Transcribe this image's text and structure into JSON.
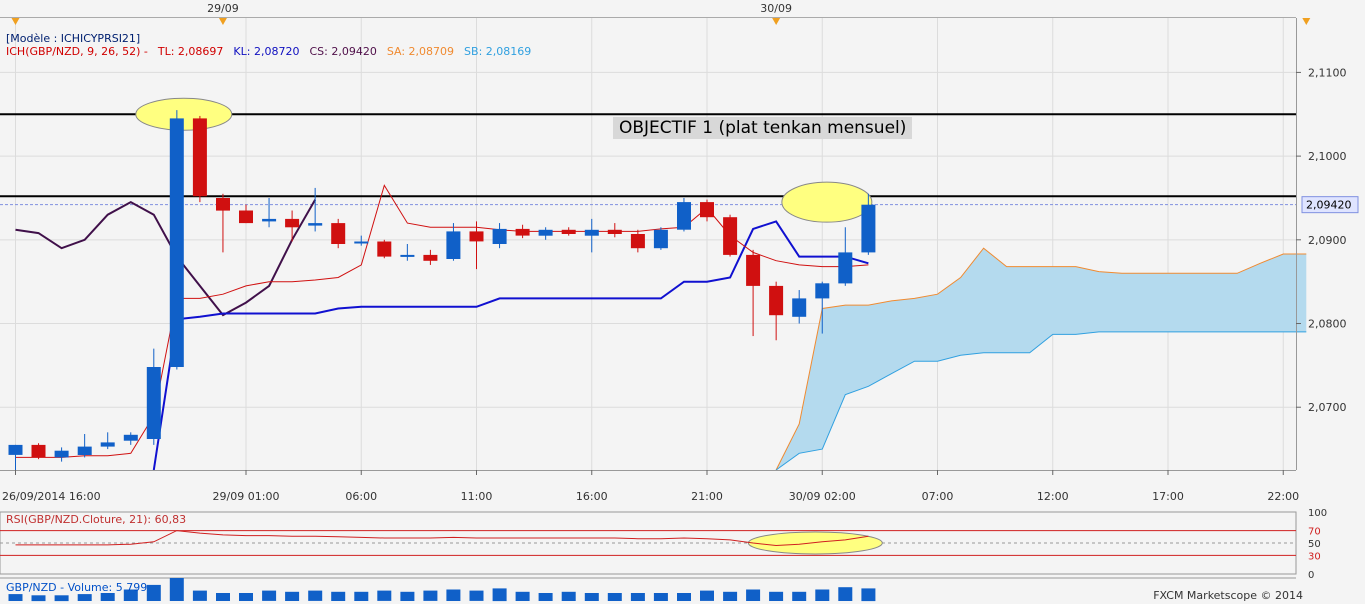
{
  "header": {
    "model": "[Modèle : ICHICYPRSI21]",
    "ichimoku_label": "ICH(GBP/NZD, 9, 26, 52) -",
    "tl_label": "TL: 2,08697",
    "kl_label": "KL: 2,08720",
    "cs_label": "CS: 2,09420",
    "sa_label": "SA: 2,08709",
    "sb_label": "SB: 2,08169"
  },
  "top_markers": [
    "29/09",
    "30/09"
  ],
  "annotation": "OBJECTIF 1 (plat tenkan mensuel)",
  "price_axis": {
    "ticks": [
      "2,1100",
      "2,1000",
      "2,0900",
      "2,0800",
      "2,0700"
    ],
    "tick_values": [
      2.11,
      2.1,
      2.09,
      2.08,
      2.07
    ],
    "ylim": [
      2.0625,
      2.1165
    ],
    "current": "2,09420",
    "current_value": 2.0942
  },
  "time_axis": {
    "labels": [
      "26/09/2014 16:00",
      "29/09 01:00",
      "06:00",
      "11:00",
      "16:00",
      "21:00",
      "30/09 02:00",
      "07:00",
      "12:00",
      "17:00",
      "22:00"
    ],
    "label_slots": [
      0,
      10,
      15,
      20,
      25,
      30,
      35,
      40,
      45,
      50,
      55
    ]
  },
  "rsi": {
    "label": "RSI(GBP/NZD.Cloture, 21): 60,83",
    "ticks": [
      "100",
      "70",
      "50",
      "30",
      "0"
    ],
    "tick_values": [
      100,
      70,
      50,
      30,
      0
    ],
    "value": 60.83
  },
  "volume": {
    "label": "GBP/NZD - Volume: 5 799"
  },
  "footer": "FXCM Marketscope © 2014",
  "colors": {
    "bull": "#1060c8",
    "bear": "#d01010",
    "tenkan": "#d01010",
    "kijun": "#1010d0",
    "chikou": "#40104a",
    "senkou_a": "#f08a30",
    "senkou_b": "#30a0e0",
    "cloud": "#b4daee",
    "highlight": "#ffff80",
    "rsi_line": "#d02020"
  },
  "chart_data": {
    "type": "candlestick",
    "symbol": "GBP/NZD",
    "timeframe": "1 hour",
    "horizontal_lines": [
      2.105,
      2.0952
    ],
    "candles": [
      {
        "o": 2.0643,
        "h": 2.0655,
        "l": 2.0625,
        "c": 2.0655
      },
      {
        "o": 2.0655,
        "h": 2.0657,
        "l": 2.0638,
        "c": 2.064
      },
      {
        "o": 2.064,
        "h": 2.0652,
        "l": 2.0635,
        "c": 2.0648
      },
      {
        "o": 2.0643,
        "h": 2.0668,
        "l": 2.064,
        "c": 2.0653
      },
      {
        "o": 2.0653,
        "h": 2.067,
        "l": 2.065,
        "c": 2.0658
      },
      {
        "o": 2.066,
        "h": 2.067,
        "l": 2.0655,
        "c": 2.0667
      },
      {
        "o": 2.0662,
        "h": 2.077,
        "l": 2.0655,
        "c": 2.0748
      },
      {
        "o": 2.0748,
        "h": 2.1055,
        "l": 2.0745,
        "c": 2.1045
      },
      {
        "o": 2.1045,
        "h": 2.1048,
        "l": 2.0945,
        "c": 2.0952
      },
      {
        "o": 2.095,
        "h": 2.0955,
        "l": 2.0885,
        "c": 2.0935
      },
      {
        "o": 2.0935,
        "h": 2.0942,
        "l": 2.092,
        "c": 2.092
      },
      {
        "o": 2.0922,
        "h": 2.095,
        "l": 2.0915,
        "c": 2.0925
      },
      {
        "o": 2.0925,
        "h": 2.0935,
        "l": 2.0898,
        "c": 2.0915
      },
      {
        "o": 2.0917,
        "h": 2.0962,
        "l": 2.091,
        "c": 2.092
      },
      {
        "o": 2.092,
        "h": 2.0925,
        "l": 2.089,
        "c": 2.0895
      },
      {
        "o": 2.0897,
        "h": 2.0905,
        "l": 2.0893,
        "c": 2.0898
      },
      {
        "o": 2.0898,
        "h": 2.09,
        "l": 2.0878,
        "c": 2.088
      },
      {
        "o": 2.088,
        "h": 2.0895,
        "l": 2.0875,
        "c": 2.0882
      },
      {
        "o": 2.0882,
        "h": 2.0888,
        "l": 2.087,
        "c": 2.0875
      },
      {
        "o": 2.0877,
        "h": 2.092,
        "l": 2.0875,
        "c": 2.091
      },
      {
        "o": 2.091,
        "h": 2.0922,
        "l": 2.0865,
        "c": 2.0898
      },
      {
        "o": 2.0895,
        "h": 2.092,
        "l": 2.089,
        "c": 2.0913
      },
      {
        "o": 2.0913,
        "h": 2.0918,
        "l": 2.0902,
        "c": 2.0905
      },
      {
        "o": 2.0905,
        "h": 2.0915,
        "l": 2.09,
        "c": 2.0912
      },
      {
        "o": 2.0912,
        "h": 2.0915,
        "l": 2.0905,
        "c": 2.0907
      },
      {
        "o": 2.0905,
        "h": 2.0925,
        "l": 2.0885,
        "c": 2.0912
      },
      {
        "o": 2.0912,
        "h": 2.092,
        "l": 2.0903,
        "c": 2.0907
      },
      {
        "o": 2.0907,
        "h": 2.0912,
        "l": 2.0885,
        "c": 2.089
      },
      {
        "o": 2.089,
        "h": 2.0915,
        "l": 2.0888,
        "c": 2.0912
      },
      {
        "o": 2.0912,
        "h": 2.095,
        "l": 2.091,
        "c": 2.0945
      },
      {
        "o": 2.0945,
        "h": 2.0948,
        "l": 2.0922,
        "c": 2.0927
      },
      {
        "o": 2.0927,
        "h": 2.093,
        "l": 2.088,
        "c": 2.0882
      },
      {
        "o": 2.0882,
        "h": 2.0888,
        "l": 2.0785,
        "c": 2.0845
      },
      {
        "o": 2.0845,
        "h": 2.085,
        "l": 2.078,
        "c": 2.081
      },
      {
        "o": 2.0808,
        "h": 2.084,
        "l": 2.08,
        "c": 2.083
      },
      {
        "o": 2.083,
        "h": 2.085,
        "l": 2.0788,
        "c": 2.0848
      },
      {
        "o": 2.0848,
        "h": 2.0915,
        "l": 2.0845,
        "c": 2.0885
      },
      {
        "o": 2.0885,
        "h": 2.0955,
        "l": 2.0882,
        "c": 2.0942
      }
    ],
    "tenkan": [
      [
        0,
        2.064
      ],
      [
        1,
        2.064
      ],
      [
        2,
        2.064
      ],
      [
        3,
        2.0642
      ],
      [
        4,
        2.0642
      ],
      [
        5,
        2.0645
      ],
      [
        6,
        2.069
      ],
      [
        7,
        2.083
      ],
      [
        8,
        2.083
      ],
      [
        9,
        2.0835
      ],
      [
        10,
        2.0845
      ],
      [
        11,
        2.085
      ],
      [
        12,
        2.085
      ],
      [
        13,
        2.0852
      ],
      [
        14,
        2.0855
      ],
      [
        15,
        2.087
      ],
      [
        16,
        2.0965
      ],
      [
        17,
        2.092
      ],
      [
        18,
        2.0915
      ],
      [
        19,
        2.0915
      ],
      [
        20,
        2.0915
      ],
      [
        21,
        2.0912
      ],
      [
        22,
        2.091
      ],
      [
        23,
        2.091
      ],
      [
        24,
        2.091
      ],
      [
        25,
        2.091
      ],
      [
        26,
        2.091
      ],
      [
        27,
        2.091
      ],
      [
        28,
        2.0913
      ],
      [
        29,
        2.0915
      ],
      [
        30,
        2.0938
      ],
      [
        31,
        2.0905
      ],
      [
        32,
        2.0885
      ],
      [
        33,
        2.0875
      ],
      [
        34,
        2.087
      ],
      [
        35,
        2.0868
      ],
      [
        36,
        2.0868
      ],
      [
        37,
        2.087
      ]
    ],
    "kijun": [
      [
        6,
        2.0625
      ],
      [
        7,
        2.0805
      ],
      [
        8,
        2.0808
      ],
      [
        9,
        2.0812
      ],
      [
        10,
        2.0812
      ],
      [
        11,
        2.0812
      ],
      [
        12,
        2.0812
      ],
      [
        13,
        2.0812
      ],
      [
        14,
        2.0818
      ],
      [
        15,
        2.082
      ],
      [
        16,
        2.082
      ],
      [
        17,
        2.082
      ],
      [
        18,
        2.082
      ],
      [
        19,
        2.082
      ],
      [
        20,
        2.082
      ],
      [
        21,
        2.083
      ],
      [
        22,
        2.083
      ],
      [
        23,
        2.083
      ],
      [
        24,
        2.083
      ],
      [
        25,
        2.083
      ],
      [
        26,
        2.083
      ],
      [
        27,
        2.083
      ],
      [
        28,
        2.083
      ],
      [
        29,
        2.085
      ],
      [
        30,
        2.085
      ],
      [
        31,
        2.0855
      ],
      [
        32,
        2.0913
      ],
      [
        33,
        2.0922
      ],
      [
        34,
        2.088
      ],
      [
        35,
        2.088
      ],
      [
        36,
        2.088
      ],
      [
        37,
        2.0872
      ]
    ],
    "chikou": [
      [
        0,
        2.0912
      ],
      [
        1,
        2.0908
      ],
      [
        2,
        2.089
      ],
      [
        3,
        2.09
      ],
      [
        4,
        2.093
      ],
      [
        5,
        2.0945
      ],
      [
        6,
        2.093
      ],
      [
        7,
        2.088
      ],
      [
        8,
        2.0845
      ],
      [
        9,
        2.081
      ],
      [
        10,
        2.0825
      ],
      [
        11,
        2.0845
      ],
      [
        12,
        2.09
      ],
      [
        13,
        2.0948
      ]
    ],
    "senkou_a": [
      [
        33,
        2.0625
      ],
      [
        34,
        2.068
      ],
      [
        35,
        2.0818
      ],
      [
        36,
        2.0822
      ],
      [
        37,
        2.0822
      ],
      [
        38,
        2.0827
      ],
      [
        39,
        2.083
      ],
      [
        40,
        2.0835
      ],
      [
        41,
        2.0855
      ],
      [
        42,
        2.089
      ],
      [
        43,
        2.0868
      ],
      [
        44,
        2.0868
      ],
      [
        45,
        2.0868
      ],
      [
        46,
        2.0868
      ],
      [
        47,
        2.0862
      ],
      [
        48,
        2.086
      ],
      [
        49,
        2.086
      ],
      [
        50,
        2.086
      ],
      [
        51,
        2.086
      ],
      [
        52,
        2.086
      ],
      [
        53,
        2.086
      ],
      [
        54,
        2.0872
      ],
      [
        55,
        2.0883
      ],
      [
        56,
        2.0883
      ]
    ],
    "senkou_b": [
      [
        33,
        2.0625
      ],
      [
        34,
        2.0645
      ],
      [
        35,
        2.065
      ],
      [
        36,
        2.0715
      ],
      [
        37,
        2.0725
      ],
      [
        38,
        2.074
      ],
      [
        39,
        2.0755
      ],
      [
        40,
        2.0755
      ],
      [
        41,
        2.0762
      ],
      [
        42,
        2.0765
      ],
      [
        43,
        2.0765
      ],
      [
        44,
        2.0765
      ],
      [
        45,
        2.0787
      ],
      [
        46,
        2.0787
      ],
      [
        47,
        2.079
      ],
      [
        48,
        2.079
      ],
      [
        49,
        2.079
      ],
      [
        50,
        2.079
      ],
      [
        51,
        2.079
      ],
      [
        52,
        2.079
      ],
      [
        53,
        2.079
      ],
      [
        54,
        2.079
      ],
      [
        55,
        2.079
      ],
      [
        56,
        2.079
      ]
    ],
    "rsi_series": [
      [
        0,
        47
      ],
      [
        1,
        47
      ],
      [
        2,
        47
      ],
      [
        3,
        47
      ],
      [
        4,
        47
      ],
      [
        5,
        48
      ],
      [
        6,
        52
      ],
      [
        7,
        70
      ],
      [
        8,
        66
      ],
      [
        9,
        63
      ],
      [
        10,
        62
      ],
      [
        11,
        62
      ],
      [
        12,
        61
      ],
      [
        13,
        61
      ],
      [
        14,
        60
      ],
      [
        15,
        59
      ],
      [
        16,
        58
      ],
      [
        17,
        58
      ],
      [
        18,
        58
      ],
      [
        19,
        59
      ],
      [
        20,
        58
      ],
      [
        21,
        58
      ],
      [
        22,
        58
      ],
      [
        23,
        58
      ],
      [
        24,
        58
      ],
      [
        25,
        58
      ],
      [
        26,
        58
      ],
      [
        27,
        57
      ],
      [
        28,
        57
      ],
      [
        29,
        58
      ],
      [
        30,
        57
      ],
      [
        31,
        55
      ],
      [
        32,
        50
      ],
      [
        33,
        46
      ],
      [
        34,
        48
      ],
      [
        35,
        52
      ],
      [
        36,
        55
      ],
      [
        37,
        61
      ]
    ],
    "volume": [
      30,
      25,
      25,
      30,
      35,
      50,
      70,
      100,
      45,
      35,
      35,
      45,
      40,
      45,
      40,
      40,
      45,
      40,
      45,
      50,
      45,
      55,
      40,
      35,
      40,
      35,
      35,
      35,
      35,
      35,
      45,
      40,
      50,
      40,
      40,
      50,
      60,
      55
    ],
    "volume_max": 100
  }
}
